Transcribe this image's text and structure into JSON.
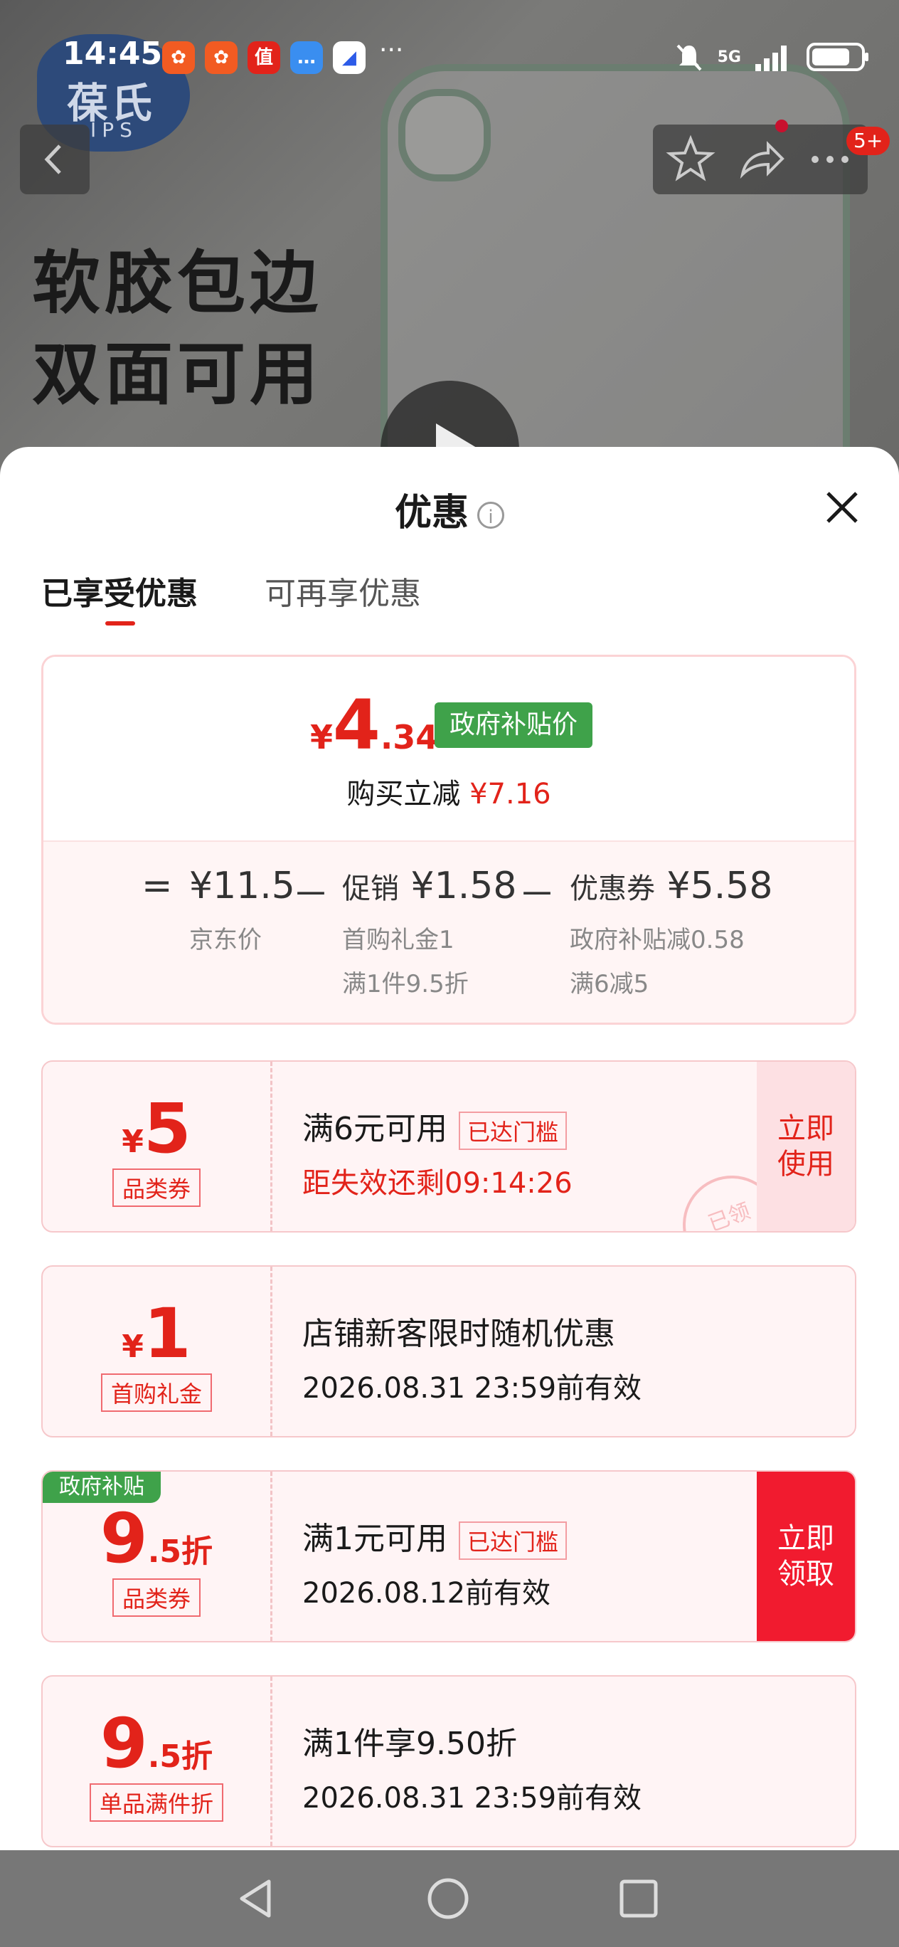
{
  "status_bar": {
    "time": "14:45",
    "app_icons": [
      "app-icon-1",
      "app-icon-2",
      "zhi-app-icon",
      "message-icon",
      "browser-icon"
    ],
    "overflow": "···",
    "network": "5G"
  },
  "product": {
    "brand_cn": "葆氏",
    "brand_en": "IPS",
    "hero_line1": "软胶包边",
    "hero_line2": "双面可用",
    "cart_badge": "5+"
  },
  "sheet": {
    "title": "优惠",
    "tabs": [
      {
        "label": "已享受优惠",
        "active": true
      },
      {
        "label": "可再享优惠",
        "active": false
      }
    ]
  },
  "summary": {
    "price_yen": "¥",
    "price_int": "4",
    "price_dec": ".34",
    "gov_tag": "政府补贴价",
    "reduce_label": "购买立减",
    "reduce_value": "¥7.16",
    "eq_sign": "=",
    "jd_price": "¥11.5",
    "jd_label": "京东价",
    "minus": "－",
    "promo_label": "促销",
    "promo_value": "¥1.58",
    "promo_sub1": "首购礼金1",
    "promo_sub2": "满1件9.5折",
    "coupon_label": "优惠券",
    "coupon_value": "¥5.58",
    "coupon_sub1": "政府补贴减0.58",
    "coupon_sub2": "满6减5"
  },
  "coupons": [
    {
      "yen": "¥",
      "amount": "5",
      "suffix": "",
      "type": "品类券",
      "condition": "满6元可用",
      "reached": "已达门槛",
      "validity": "距失效还剩09:14:26",
      "validity_red": true,
      "action": "立即使用",
      "action_style": "use",
      "stamp": "已领",
      "gov_corner": ""
    },
    {
      "yen": "¥",
      "amount": "1",
      "suffix": "",
      "type": "首购礼金",
      "condition": "店铺新客限时随机优惠",
      "reached": "",
      "validity": "2026.08.31 23:59前有效",
      "validity_red": false,
      "action": "",
      "action_style": "",
      "stamp": "",
      "gov_corner": ""
    },
    {
      "yen": "",
      "amount": "9",
      "suffix": ".5折",
      "type": "品类券",
      "condition": "满1元可用",
      "reached": "已达门槛",
      "validity": "2026.08.12前有效",
      "validity_red": false,
      "action": "立即领取",
      "action_style": "get",
      "stamp": "",
      "gov_corner": "政府补贴"
    },
    {
      "yen": "",
      "amount": "9",
      "suffix": ".5折",
      "type": "单品满件折",
      "condition": "满1件享9.50折",
      "reached": "",
      "validity": "2026.08.31 23:59前有效",
      "validity_red": false,
      "action": "",
      "action_style": "",
      "stamp": "",
      "gov_corner": ""
    }
  ],
  "colors": {
    "accent": "#e2231a",
    "gov_green": "#3fa24a",
    "coupon_bg": "#fff4f5"
  }
}
